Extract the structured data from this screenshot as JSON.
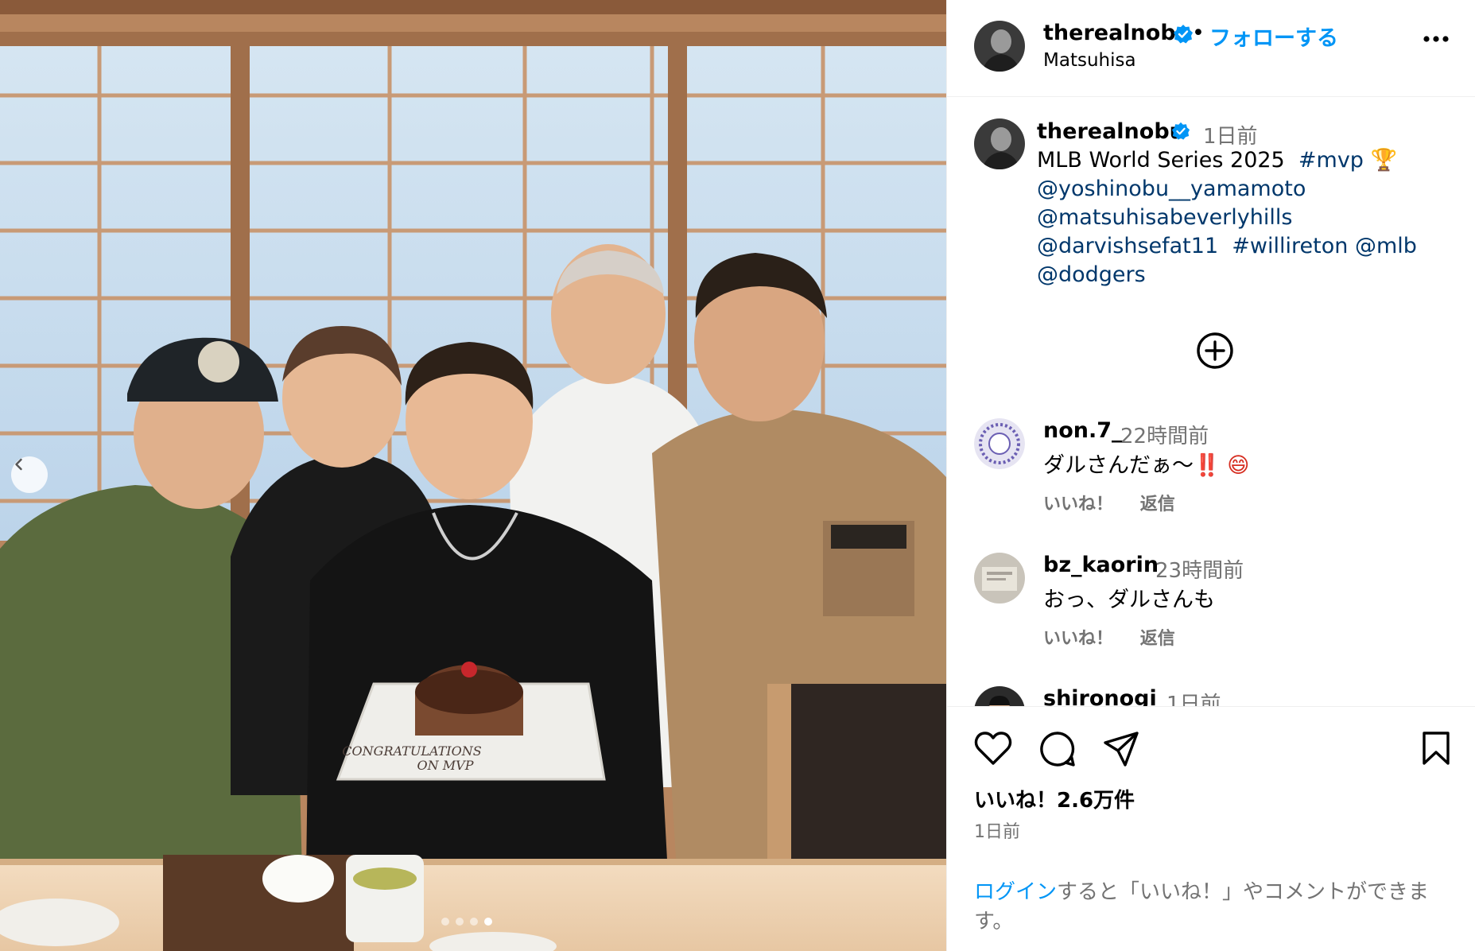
{
  "photo": {
    "alt_people_count": 5,
    "cake_text_line1": "CONGRATULATIONS",
    "cake_text_line2": "ON   MVP",
    "carousel": {
      "total": 4,
      "active": 4
    }
  },
  "header": {
    "username": "therealnobu",
    "separator": "•",
    "follow_label": "フォローする",
    "location": "Matsuhisa"
  },
  "caption": {
    "username": "therealnobu",
    "time": "1日前",
    "text_plain": "MLB World Series 2025",
    "hashtag_mvp": "#mvp",
    "trophy": "🏆",
    "mention1": "@yoshinobu__yamamoto",
    "mention2": "@matsuhisabeverlyhills",
    "mention3": "@darvishsefat11",
    "hashtag2": "#willireton",
    "mention4": "@mlb",
    "mention5": "@dodgers"
  },
  "comments": [
    {
      "username": "non.7_",
      "time": "22時間前",
      "text": "ダルさんだぁ〜",
      "emoji": "‼️ 😄",
      "like": "いいね！",
      "reply": "返信"
    },
    {
      "username": "bz_kaorin",
      "time": "23時間前",
      "text": "おっ、ダルさんも",
      "like": "いいね！",
      "reply": "返信"
    },
    {
      "username": "shironogi",
      "time": "1日前"
    }
  ],
  "actions": {
    "likes": "いいね！2.6万件",
    "posted": "1日前",
    "login_link": "ログイン",
    "login_rest": "すると「いいね！」やコメントができます。"
  },
  "colors": {
    "accent": "#0095f6",
    "mention": "#00376b",
    "muted": "#737373"
  },
  "icons": [
    "verified-badge-icon",
    "more-options-icon",
    "add-circle-icon",
    "heart-icon",
    "comment-icon",
    "share-icon",
    "bookmark-icon",
    "chevron-left-icon"
  ]
}
